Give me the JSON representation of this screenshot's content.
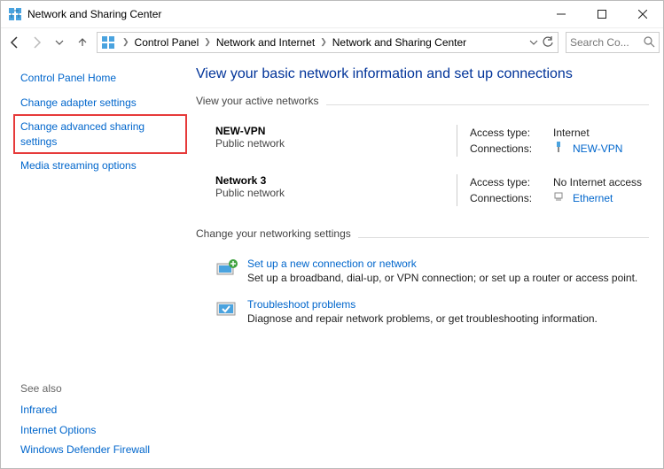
{
  "window": {
    "title": "Network and Sharing Center"
  },
  "breadcrumb": {
    "items": [
      "Control Panel",
      "Network and Internet",
      "Network and Sharing Center"
    ]
  },
  "search": {
    "placeholder": "Search Co..."
  },
  "sidebar": {
    "home": "Control Panel Home",
    "adapter": "Change adapter settings",
    "advanced": "Change advanced sharing settings",
    "media": "Media streaming options",
    "seealso_hdr": "See also",
    "seealso": [
      "Infrared",
      "Internet Options",
      "Windows Defender Firewall"
    ]
  },
  "main": {
    "heading": "View your basic network information and set up connections",
    "active_hdr": "View your active networks",
    "networks": [
      {
        "name": "NEW-VPN",
        "type": "Public network",
        "access_lbl": "Access type:",
        "access_val": "Internet",
        "conn_lbl": "Connections:",
        "conn_val": "NEW-VPN"
      },
      {
        "name": "Network 3",
        "type": "Public network",
        "access_lbl": "Access type:",
        "access_val": "No Internet access",
        "conn_lbl": "Connections:",
        "conn_val": "Ethernet"
      }
    ],
    "change_hdr": "Change your networking settings",
    "tasks": [
      {
        "title": "Set up a new connection or network",
        "desc": "Set up a broadband, dial-up, or VPN connection; or set up a router or access point."
      },
      {
        "title": "Troubleshoot problems",
        "desc": "Diagnose and repair network problems, or get troubleshooting information."
      }
    ]
  }
}
